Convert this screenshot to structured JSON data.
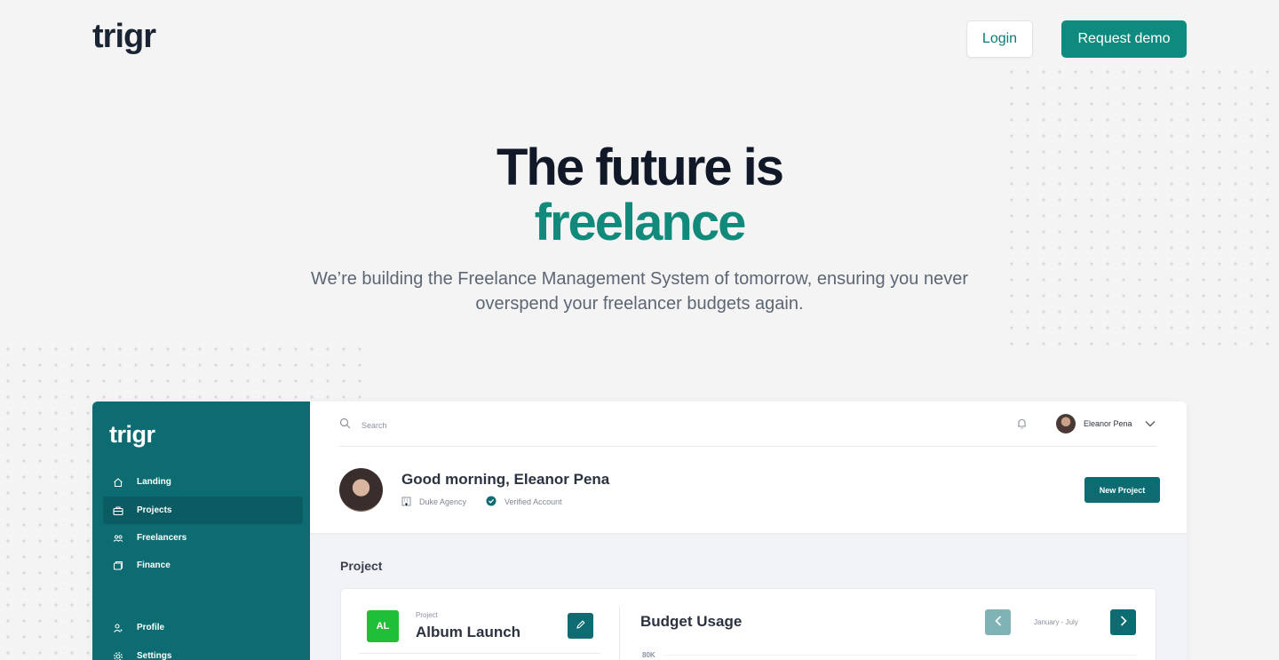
{
  "header": {
    "logo": "trigr",
    "login_label": "Login",
    "demo_label": "Request demo"
  },
  "hero": {
    "title_line1": "The future is",
    "title_line2": "freelance",
    "subtitle": "We’re building the Freelance Management System of tomorrow, ensuring you never overspend your freelancer budgets again."
  },
  "app": {
    "sidebar": {
      "logo": "trigr",
      "items": [
        {
          "label": "Landing",
          "icon": "home-icon"
        },
        {
          "label": "Projects",
          "icon": "briefcase-icon",
          "active": true
        },
        {
          "label": "Freelancers",
          "icon": "users-icon"
        },
        {
          "label": "Finance",
          "icon": "finance-icon"
        },
        {
          "label": "Profile",
          "icon": "profile-icon"
        },
        {
          "label": "Settings",
          "icon": "settings-icon"
        }
      ]
    },
    "topbar": {
      "search_placeholder": "Search",
      "user_name": "Eleanor Pena"
    },
    "greeting": "Good morning, Eleanor Pena",
    "agency": "Duke Agency",
    "verified": "Verified Account",
    "new_project_label": "New Project",
    "section_title": "Project",
    "project": {
      "initials": "AL",
      "label": "Project",
      "name": "Album Launch"
    },
    "budget": {
      "title": "Budget Usage",
      "range": "January - July",
      "y_tick": "80K"
    }
  },
  "colors": {
    "brand": "#0e8a7e",
    "sidebar": "#0c6c72",
    "accent_green": "#1fbf3a"
  }
}
